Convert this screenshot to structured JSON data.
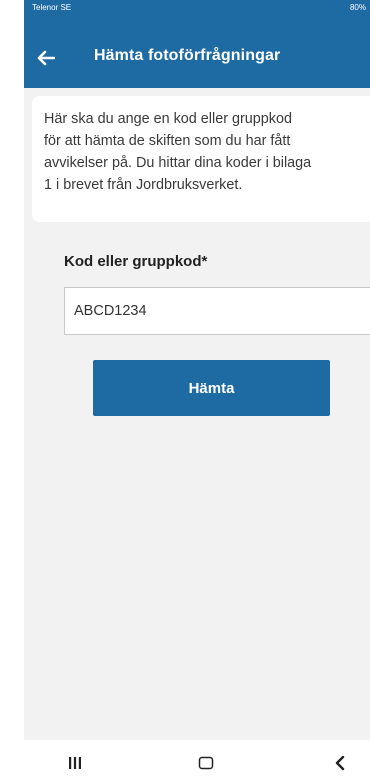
{
  "status_bar": {
    "carrier": "Telenor SE",
    "battery": "80%"
  },
  "app_bar": {
    "back_icon": "arrow-left-icon",
    "title": "Hämta fotoförfrågningar"
  },
  "info_card": {
    "lines": [
      "Här ska du ange en kod eller gruppkod",
      "för att hämta de skiften som du har fått",
      "avvikelser på. Du hittar dina koder i bilaga",
      "1 i brevet från Jordbruksverket."
    ]
  },
  "form": {
    "code_label": "Kod eller gruppkod*",
    "code_value": "ABCD1234",
    "submit_label": "Hämta"
  },
  "nav_bar": {
    "icons": [
      "recent-apps-icon",
      "home-icon",
      "back-icon"
    ]
  },
  "colors": {
    "primary": "#1e6aa3",
    "background": "#f2f2f2",
    "card": "#ffffff"
  }
}
